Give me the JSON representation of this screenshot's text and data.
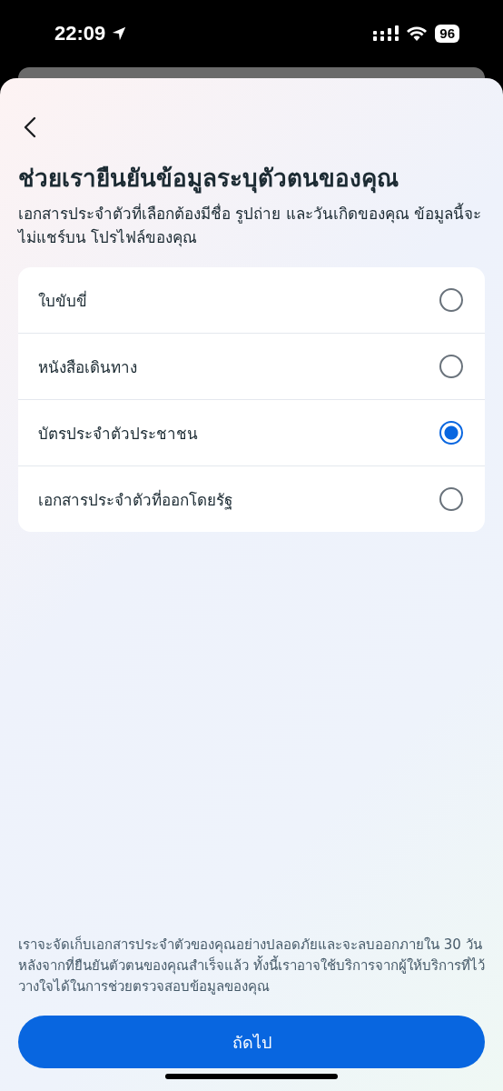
{
  "status_bar": {
    "time": "22:09",
    "battery": "96"
  },
  "title": "ช่วยเรายืนยันข้อมูลระบุตัวตนของคุณ",
  "subtitle": "เอกสารประจำตัวที่เลือกต้องมีชื่อ รูปถ่าย และวันเกิดของคุณ ข้อมูลนี้จะไม่แชร์บน โปรไฟล์ของคุณ",
  "options": [
    {
      "label": "ใบขับขี่",
      "selected": false
    },
    {
      "label": "หนังสือเดินทาง",
      "selected": false
    },
    {
      "label": "บัตรประจำตัวประชาชน",
      "selected": true
    },
    {
      "label": "เอกสารประจำตัวที่ออกโดยรัฐ",
      "selected": false
    }
  ],
  "footer_note": "เราจะจัดเก็บเอกสารประจำตัวของคุณอย่างปลอดภัยและจะลบออกภายใน 30 วันหลังจากที่ยืนยันตัวตนของคุณสำเร็จแล้ว ทั้งนี้เราอาจใช้บริการจากผู้ให้บริการที่ไว้วางใจได้ในการช่วยตรวจสอบข้อมูลของคุณ",
  "next_button": "ถัดไป"
}
